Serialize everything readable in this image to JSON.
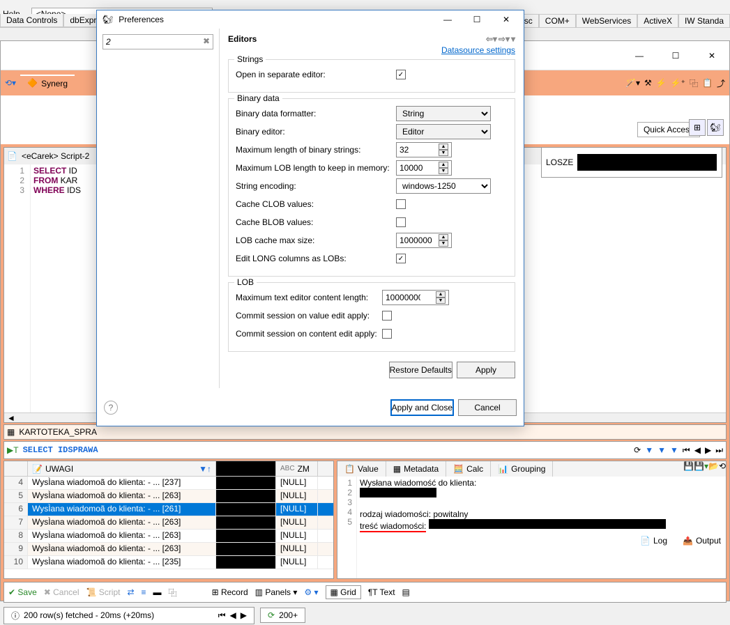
{
  "delphi": {
    "menu_help": "Help",
    "combo_none": "<None>",
    "tabs": [
      "Data Controls",
      "dbExpress",
      "Indv Misc",
      "COM+",
      "WebServices",
      "ActiveX",
      "IW Standa"
    ]
  },
  "dbeaver": {
    "synergy_tab": "Synerg",
    "quick_access": "Quick Access",
    "script_tab": "<eCarek> Script-2",
    "sql": {
      "l1a": "SELECT",
      "l1b": " ID",
      "l2a": "FROM",
      "l2b": " KAR",
      "l3a": "WHERE",
      "l3b": " IDS"
    },
    "suffix_text": "LOSZE",
    "kartoteka_tab": "KARTOTEKA_SPRA",
    "select_stmt": "SELECT IDSPRAWA",
    "log": "Log",
    "output": "Output",
    "grid": {
      "col1": "UWAGI",
      "col2": "ZM",
      "rows": [
        {
          "n": "4",
          "uwagi": "WysÌana wiadomoã do klienta: - ... [237]",
          "zm": "[NULL]"
        },
        {
          "n": "5",
          "uwagi": "WysÌana wiadomoã do klienta: - ... [263]",
          "zm": "[NULL]"
        },
        {
          "n": "6",
          "uwagi": "WysÌana wiadomoã do klienta: - ... [261]",
          "zm": "[NULL]",
          "sel": true
        },
        {
          "n": "7",
          "uwagi": "WysÌana wiadomoã do klienta: - ... [263]",
          "zm": "[NULL]"
        },
        {
          "n": "8",
          "uwagi": "WysÌana wiadomoã do klienta: - ... [263]",
          "zm": "[NULL]"
        },
        {
          "n": "9",
          "uwagi": "WysÌana wiadomoã do klienta: - ... [263]",
          "zm": "[NULL]"
        },
        {
          "n": "10",
          "uwagi": "WysÌana wiadomoã do klienta: - ... [235]",
          "zm": "[NULL]"
        }
      ]
    },
    "rp": {
      "tabs": [
        "Value",
        "Metadata",
        "Calc",
        "Grouping"
      ],
      "l1": "Wysłana wiadomość do klienta:",
      "l4": "rodzaj wiadomości: powitalny",
      "l5": "treść wiadomości:"
    },
    "bottom": {
      "save": "Save",
      "cancel": "Cancel",
      "script": "Script",
      "record": "Record",
      "panels": "Panels",
      "grid": "Grid",
      "text": "Text"
    },
    "status": {
      "msg": "200 row(s) fetched - 20ms (+20ms)",
      "plus": "200+"
    }
  },
  "pref": {
    "title": "Preferences",
    "search": "2",
    "heading": "Editors",
    "ds_link": "Datasource settings",
    "g_strings": "Strings",
    "open_separate": "Open in separate editor:",
    "g_binary": "Binary data",
    "binary_formatter": "Binary data formatter:",
    "binary_formatter_v": "String",
    "binary_editor": "Binary editor:",
    "binary_editor_v": "Editor",
    "max_bin_len": "Maximum length of binary strings:",
    "max_bin_len_v": "32",
    "max_lob_mem": "Maximum LOB length to keep in memory:",
    "max_lob_mem_v": "10000",
    "str_enc": "String encoding:",
    "str_enc_v": "windows-1250",
    "cache_clob": "Cache CLOB values:",
    "cache_blob": "Cache BLOB values:",
    "lob_cache_max": "LOB cache max size:",
    "lob_cache_max_v": "1000000",
    "edit_long": "Edit LONG columns as LOBs:",
    "g_lob": "LOB",
    "max_txt_len": "Maximum text editor content length:",
    "max_txt_len_v": "10000000",
    "commit_val": "Commit session on value edit apply:",
    "commit_content": "Commit session on content edit apply:",
    "restore": "Restore Defaults",
    "apply": "Apply",
    "apply_close": "Apply and Close",
    "cancel": "Cancel"
  }
}
